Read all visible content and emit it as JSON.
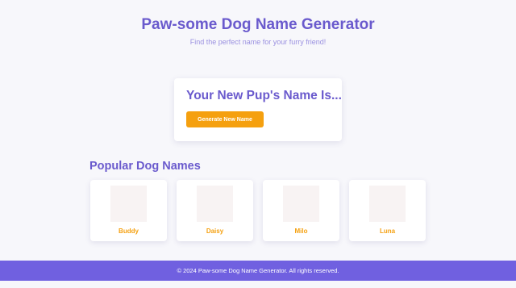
{
  "header": {
    "title": "Paw-some Dog Name Generator",
    "subtitle": "Find the perfect name for your furry friend!"
  },
  "generator": {
    "heading": "Your New Pup's Name Is...",
    "button_label": "Generate New Name"
  },
  "popular": {
    "title": "Popular Dog Names",
    "names": [
      "Buddy",
      "Daisy",
      "Milo",
      "Luna"
    ]
  },
  "footer": {
    "text": "© 2024 Paw-some Dog Name Generator. All rights reserved."
  },
  "colors": {
    "primary": "#6a5acd",
    "accent": "#f5a00f",
    "footer_bg": "#7060e0",
    "background": "#f7f7fb"
  }
}
